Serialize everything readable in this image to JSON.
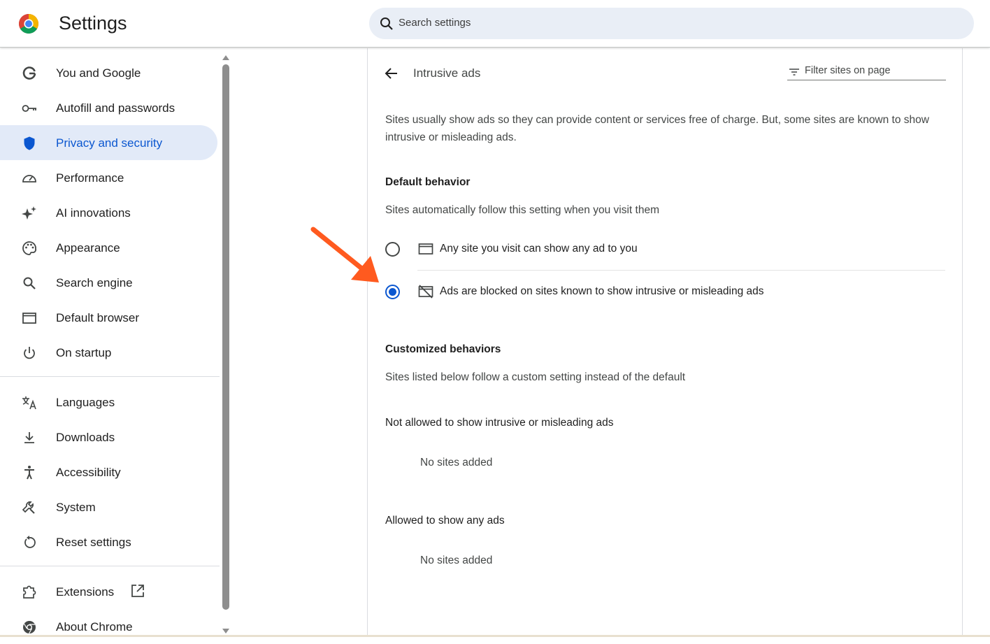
{
  "header": {
    "app_title": "Settings",
    "search_placeholder": "Search settings",
    "logo": "chrome-logo"
  },
  "sidebar": {
    "items": [
      {
        "label": "You and Google",
        "icon": "google-g-icon"
      },
      {
        "label": "Autofill and passwords",
        "icon": "key-icon"
      },
      {
        "label": "Privacy and security",
        "icon": "shield-icon",
        "active": true
      },
      {
        "label": "Performance",
        "icon": "speedometer-icon"
      },
      {
        "label": "AI innovations",
        "icon": "sparkle-icon"
      },
      {
        "label": "Appearance",
        "icon": "palette-icon"
      },
      {
        "label": "Search engine",
        "icon": "search-icon"
      },
      {
        "label": "Default browser",
        "icon": "browser-window-icon"
      },
      {
        "label": "On startup",
        "icon": "power-icon"
      },
      {
        "label": "Languages",
        "icon": "translate-icon"
      },
      {
        "label": "Downloads",
        "icon": "download-icon"
      },
      {
        "label": "Accessibility",
        "icon": "accessibility-icon"
      },
      {
        "label": "System",
        "icon": "wrench-icon"
      },
      {
        "label": "Reset settings",
        "icon": "reset-icon"
      },
      {
        "label": "Extensions",
        "icon": "puzzle-icon"
      },
      {
        "label": "About Chrome",
        "icon": "chrome-icon"
      }
    ]
  },
  "main": {
    "title": "Intrusive ads",
    "filter_placeholder": "Filter sites on page",
    "description": "Sites usually show ads so they can provide content or services free of charge. But, some sites are known to show intrusive or misleading ads.",
    "default_behavior": {
      "heading": "Default behavior",
      "subtitle": "Sites automatically follow this setting when you visit them",
      "options": [
        {
          "label": "Any site you visit can show any ad to you",
          "checked": false,
          "icon": "ad-window-icon"
        },
        {
          "label": "Ads are blocked on sites known to show intrusive or misleading ads",
          "checked": true,
          "icon": "ad-blocked-icon"
        }
      ]
    },
    "customized": {
      "heading": "Customized behaviors",
      "subtitle": "Sites listed below follow a custom setting instead of the default",
      "not_allowed_heading": "Not allowed to show intrusive or misleading ads",
      "not_allowed_empty": "No sites added",
      "allowed_heading": "Allowed to show any ads",
      "allowed_empty": "No sites added"
    }
  },
  "colors": {
    "accent": "#0b57d0",
    "active_bg": "#e2eaf8",
    "annotation_arrow": "#ff5a1f"
  }
}
